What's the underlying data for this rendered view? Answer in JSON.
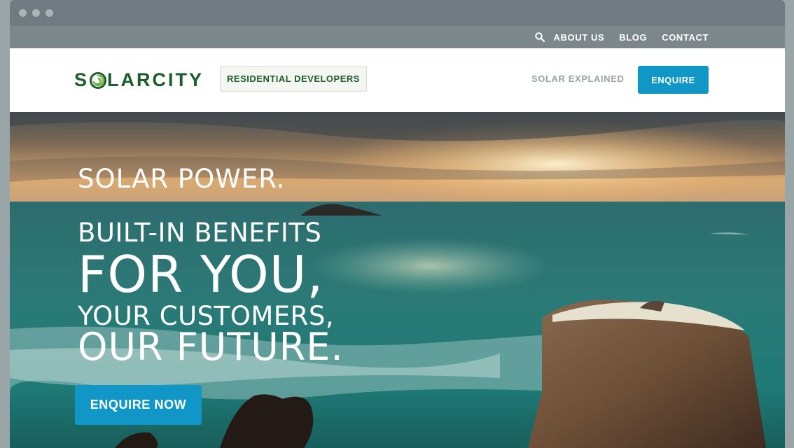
{
  "util_nav": {
    "search_icon": "search-icon",
    "about": "ABOUT US",
    "blog": "BLOG",
    "contact": "CONTACT"
  },
  "header": {
    "logo_pre": "S",
    "logo_post": "LARCITY",
    "residential": "RESIDENTIAL DEVELOPERS",
    "solar_explained": "SOLAR EXPLAINED",
    "enquire": "ENQUIRE"
  },
  "hero": {
    "line1": "SOLAR POWER.",
    "line2": "BUILT-IN BENEFITS",
    "line3": "FOR YOU,",
    "line4": "YOUR CUSTOMERS,",
    "line5": "OUR FUTURE.",
    "cta": "ENQUIRE NOW"
  },
  "colors": {
    "brand_green": "#1c5d2b",
    "accent_blue": "#1196c8",
    "nav_bar": "#7c878b"
  }
}
